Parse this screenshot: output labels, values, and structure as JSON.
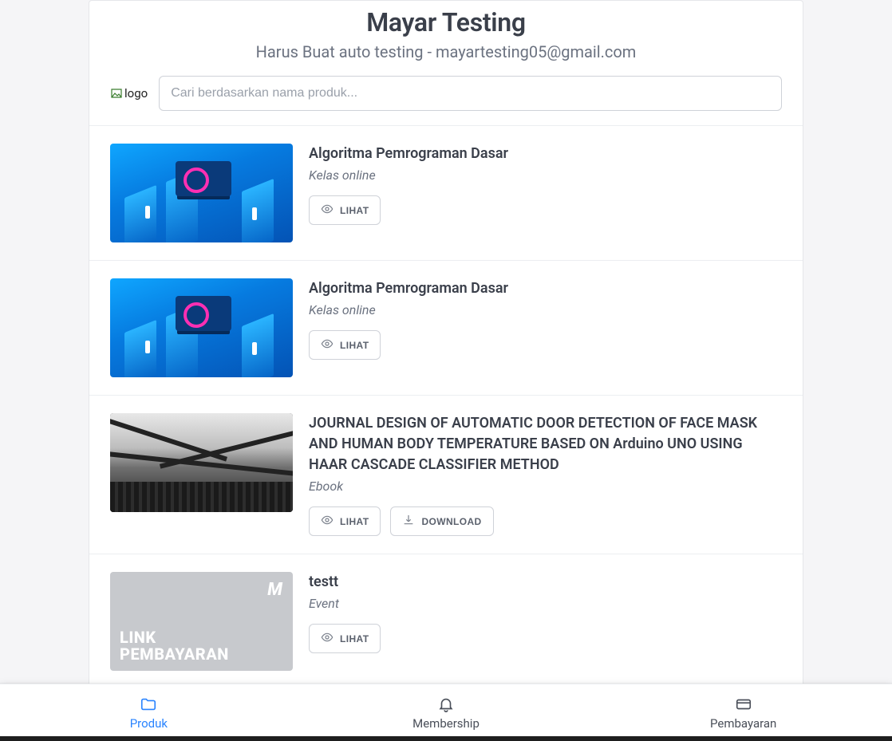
{
  "header": {
    "title": "Mayar Testing",
    "subtitle": "Harus Buat auto testing - mayartesting05@gmail.com"
  },
  "logo_alt": "logo",
  "search": {
    "placeholder": "Cari berdasarkan nama produk..."
  },
  "buttons": {
    "view": "LIHAT",
    "download": "DOWNLOAD"
  },
  "items": [
    {
      "title": "Algoritma Pemrograman Dasar",
      "type": "Kelas online",
      "thumb_style": "blue",
      "actions": [
        "view"
      ]
    },
    {
      "title": "Algoritma Pemrograman Dasar",
      "type": "Kelas online",
      "thumb_style": "blue",
      "actions": [
        "view"
      ]
    },
    {
      "title": "JOURNAL DESIGN OF AUTOMATIC DOOR DETECTION OF FACE MASK AND HUMAN BODY TEMPERATURE BASED ON Arduino UNO USING HAAR CASCADE CLASSIFIER METHOD",
      "type": "Ebook",
      "thumb_style": "mono",
      "actions": [
        "view",
        "download"
      ]
    },
    {
      "title": "testt",
      "type": "Event",
      "thumb_style": "gray",
      "thumb_badge": "M",
      "thumb_caption_line1": "LINK",
      "thumb_caption_line2": "PEMBAYARAN",
      "actions": [
        "view"
      ]
    }
  ],
  "nav": {
    "produk": "Produk",
    "membership": "Membership",
    "pembayaran": "Pembayaran",
    "active": "produk"
  }
}
